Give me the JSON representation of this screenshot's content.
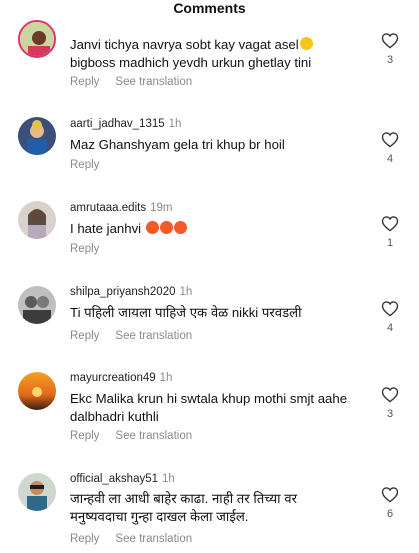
{
  "header": {
    "title": "Comments"
  },
  "actions": {
    "reply": "Reply",
    "translate": "See translation"
  },
  "comments": [
    {
      "username": "",
      "time": "",
      "text": "Janvi tichya navrya sobt kay vagat asel",
      "text2": "bigboss madhich yevdh urkun ghetlay tini",
      "likes": "3",
      "has_translate": true
    },
    {
      "username": "aarti_jadhav_1315",
      "time": "1h",
      "text": "Maz Ghanshyam gela tri khup br hoil",
      "likes": "4",
      "has_translate": false
    },
    {
      "username": "amrutaaa.edits",
      "time": "19m",
      "text": "I hate janhvi",
      "likes": "1",
      "has_translate": false
    },
    {
      "username": "shilpa_priyansh2020",
      "time": "1h",
      "text": "Ti पहिली जायला पाहिजे एक वेळ nikki परवडली",
      "likes": "4",
      "has_translate": true
    },
    {
      "username": "mayurcreation49",
      "time": "1h",
      "text": "Ekc Malika krun hi swtala khup mothi smjt aahe",
      "text2": "dalbhadri kuthli",
      "likes": "3",
      "has_translate": true
    },
    {
      "username": "official_akshay51",
      "time": "1h",
      "text": "जान्हवी ला आधी बाहेर काढा. नाही तर तिच्या वर",
      "text2": "मनुष्यवदाचा गुन्हा दाखल केला जाईल.",
      "likes": "6",
      "has_translate": true
    }
  ]
}
